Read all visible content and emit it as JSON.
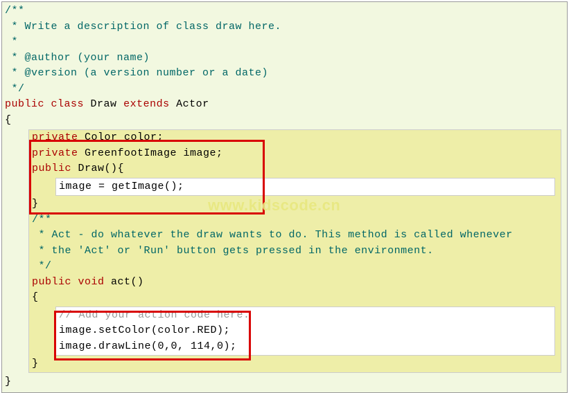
{
  "javadoc1": {
    "l1": "/**",
    "l2": " * Write a description of class draw here.",
    "l3": " * ",
    "l4": " * @author (your name) ",
    "l5": " * @version (a version number or a date)",
    "l6": " */"
  },
  "decl": {
    "public": "public",
    "class": "class",
    "name": " Draw ",
    "extends": "extends",
    "super": " Actor"
  },
  "braceOpen": "{",
  "braceClose": "}",
  "fields": {
    "private1a": "private",
    "private1b": " Color color;",
    "private2a": "private",
    "private2b": " GreenfootImage image;"
  },
  "ctor": {
    "public": "public",
    "sig": " Draw(){",
    "body": "image = getImage();",
    "close": "}"
  },
  "javadoc2": {
    "l1": "/**",
    "l2": " * Act - do whatever the draw wants to do. This method is called whenever",
    "l3": " * the 'Act' or 'Run' button gets pressed in the environment.",
    "l4": " */"
  },
  "act": {
    "public": "public",
    "void": "void",
    "name": " act()   ",
    "open": "{",
    "comment": "// Add your action code here.",
    "l1": "image.setColor(color.RED);",
    "l2": "image.drawLine(0,0, 114,0);",
    "close": "}    "
  },
  "watermark": "www.kidscode.cn"
}
